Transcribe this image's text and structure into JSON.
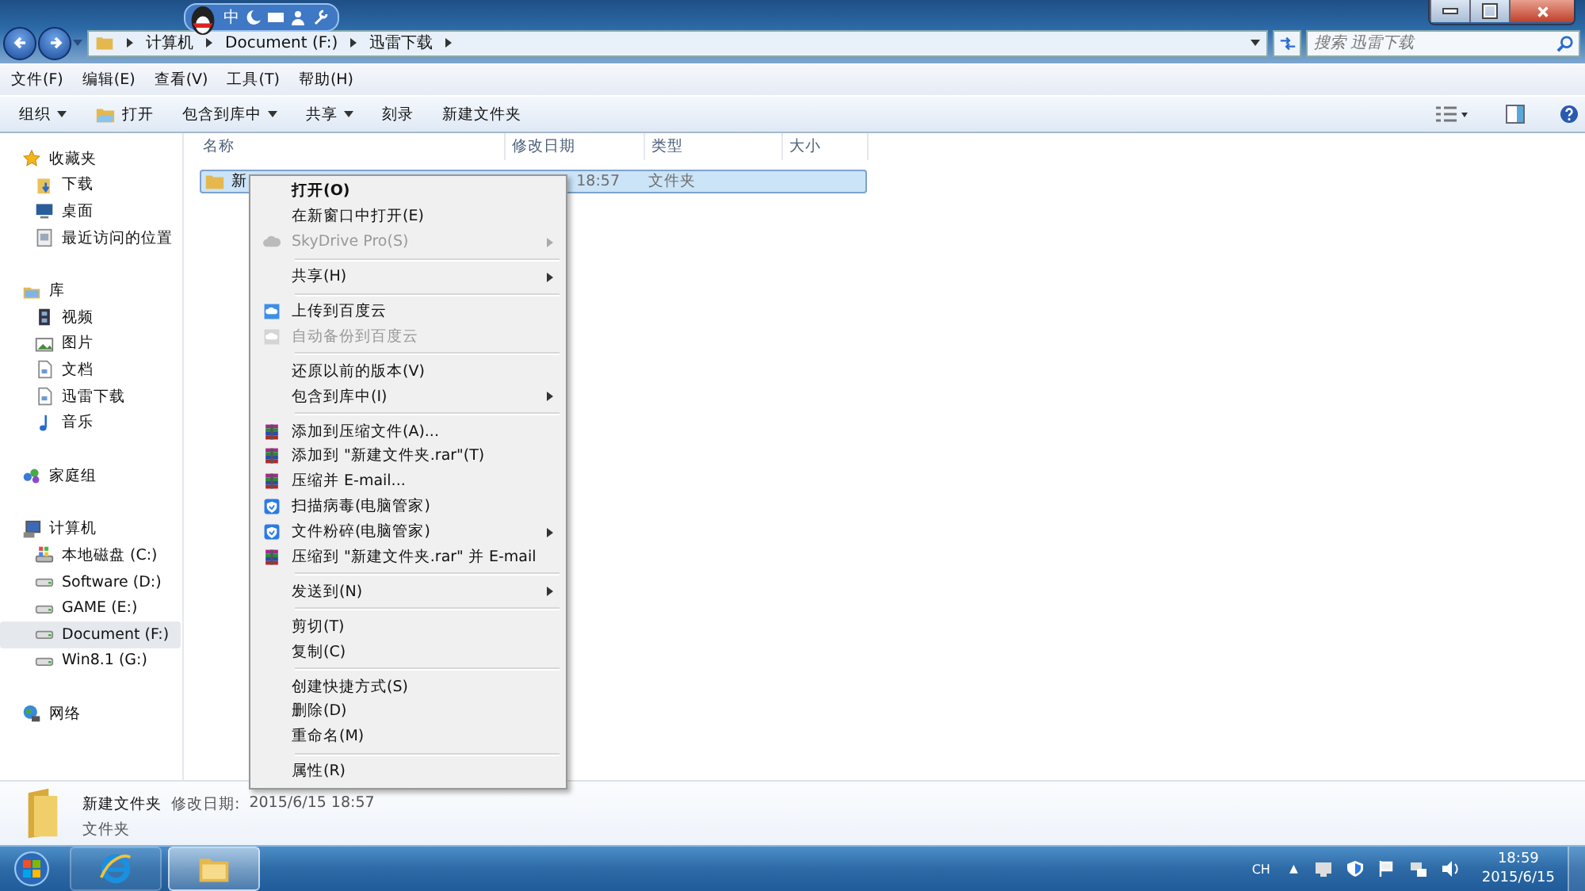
{
  "address": {
    "crumbs": [
      "计算机",
      "Document (F:)",
      "迅雷下载"
    ],
    "search_placeholder": "搜索 迅雷下载"
  },
  "ime_toolbar": {
    "label": "中"
  },
  "menubar": [
    "文件(F)",
    "编辑(E)",
    "查看(V)",
    "工具(T)",
    "帮助(H)"
  ],
  "commands": [
    {
      "label": "组织",
      "dropdown": true
    },
    {
      "label": "打开",
      "dropdown": false
    },
    {
      "label": "包含到库中",
      "dropdown": true
    },
    {
      "label": "共享",
      "dropdown": true
    },
    {
      "label": "刻录",
      "dropdown": false
    },
    {
      "label": "新建文件夹",
      "dropdown": false
    }
  ],
  "sidebar": [
    {
      "label": "收藏夹",
      "kind": "star",
      "selected": false,
      "children": [
        {
          "label": "下载",
          "kind": "download",
          "selected": false
        },
        {
          "label": "桌面",
          "kind": "desktop",
          "selected": false
        },
        {
          "label": "最近访问的位置",
          "kind": "recent",
          "selected": false
        }
      ]
    },
    {
      "label": "库",
      "kind": "library",
      "selected": false,
      "children": [
        {
          "label": "视频",
          "kind": "video",
          "selected": false
        },
        {
          "label": "图片",
          "kind": "image",
          "selected": false
        },
        {
          "label": "文档",
          "kind": "doc",
          "selected": false
        },
        {
          "label": "迅雷下载",
          "kind": "doc",
          "selected": false
        },
        {
          "label": "音乐",
          "kind": "music",
          "selected": false
        }
      ]
    },
    {
      "label": "家庭组",
      "kind": "homegroup",
      "selected": false
    },
    {
      "label": "计算机",
      "kind": "computer",
      "selected": false,
      "children": [
        {
          "label": "本地磁盘 (C:)",
          "kind": "sysdrive",
          "selected": false
        },
        {
          "label": "Software (D:)",
          "kind": "drive",
          "selected": false
        },
        {
          "label": "GAME (E:)",
          "kind": "drive",
          "selected": false
        },
        {
          "label": "Document (F:)",
          "kind": "drive",
          "selected": true
        },
        {
          "label": "Win8.1 (G:)",
          "kind": "drive",
          "selected": false
        }
      ]
    },
    {
      "label": "网络",
      "kind": "network",
      "selected": false
    }
  ],
  "table": {
    "columns": [
      "名称",
      "修改日期",
      "类型",
      "大小"
    ],
    "rows": [
      {
        "name": "新",
        "modified": "18:57",
        "type": "文件夹",
        "selected": true
      }
    ]
  },
  "context_menu": [
    {
      "kind": "plain",
      "label": "打开(O)",
      "bold": true,
      "disabled": false,
      "submenu": false
    },
    {
      "kind": "plain",
      "label": "在新窗口中打开(E)",
      "bold": false,
      "disabled": false,
      "submenu": false
    },
    {
      "kind": "cloud",
      "label": "SkyDrive Pro(S)",
      "bold": false,
      "disabled": true,
      "submenu": true
    },
    {
      "kind": "separator"
    },
    {
      "kind": "plain",
      "label": "共享(H)",
      "bold": false,
      "disabled": false,
      "submenu": true
    },
    {
      "kind": "separator"
    },
    {
      "kind": "upload",
      "label": "上传到百度云",
      "bold": false,
      "disabled": false,
      "submenu": false
    },
    {
      "kind": "upload",
      "label": "自动备份到百度云",
      "bold": false,
      "disabled": true,
      "submenu": false
    },
    {
      "kind": "separator"
    },
    {
      "kind": "plain",
      "label": "还原以前的版本(V)",
      "bold": false,
      "disabled": false,
      "submenu": false
    },
    {
      "kind": "plain",
      "label": "包含到库中(I)",
      "bold": false,
      "disabled": false,
      "submenu": true
    },
    {
      "kind": "separator"
    },
    {
      "kind": "archive",
      "label": "添加到压缩文件(A)...",
      "bold": false,
      "disabled": false,
      "submenu": false
    },
    {
      "kind": "archive",
      "label": "添加到 \"新建文件夹.rar\"(T)",
      "bold": false,
      "disabled": false,
      "submenu": false
    },
    {
      "kind": "archive",
      "label": "压缩并 E-mail...",
      "bold": false,
      "disabled": false,
      "submenu": false
    },
    {
      "kind": "shield",
      "label": "扫描病毒(电脑管家)",
      "bold": false,
      "disabled": false,
      "submenu": false
    },
    {
      "kind": "shield",
      "label": "文件粉碎(电脑管家)",
      "bold": false,
      "disabled": false,
      "submenu": true
    },
    {
      "kind": "archive",
      "label": "压缩到 \"新建文件夹.rar\" 并 E-mail",
      "bold": false,
      "disabled": false,
      "submenu": false
    },
    {
      "kind": "separator"
    },
    {
      "kind": "plain",
      "label": "发送到(N)",
      "bold": false,
      "disabled": false,
      "submenu": true
    },
    {
      "kind": "separator"
    },
    {
      "kind": "plain",
      "label": "剪切(T)",
      "bold": false,
      "disabled": false,
      "submenu": false
    },
    {
      "kind": "plain",
      "label": "复制(C)",
      "bold": false,
      "disabled": false,
      "submenu": false
    },
    {
      "kind": "separator"
    },
    {
      "kind": "plain",
      "label": "创建快捷方式(S)",
      "bold": false,
      "disabled": false,
      "submenu": false
    },
    {
      "kind": "plain",
      "label": "删除(D)",
      "bold": false,
      "disabled": false,
      "submenu": false
    },
    {
      "kind": "plain",
      "label": "重命名(M)",
      "bold": false,
      "disabled": false,
      "submenu": false
    },
    {
      "kind": "separator"
    },
    {
      "kind": "plain",
      "label": "属性(R)",
      "bold": false,
      "disabled": false,
      "submenu": false
    }
  ],
  "details": {
    "name": "新建文件夹",
    "modified_label": "修改日期:",
    "modified": "2015/6/15 18:57",
    "type": "文件夹"
  },
  "taskbar": {
    "apps": [
      {
        "kind": "browser",
        "selected": false
      },
      {
        "kind": "explorer",
        "selected": true
      }
    ],
    "language": "CH",
    "tray_arrow": "▲",
    "time": "18:59",
    "date": "2015/6/15"
  }
}
